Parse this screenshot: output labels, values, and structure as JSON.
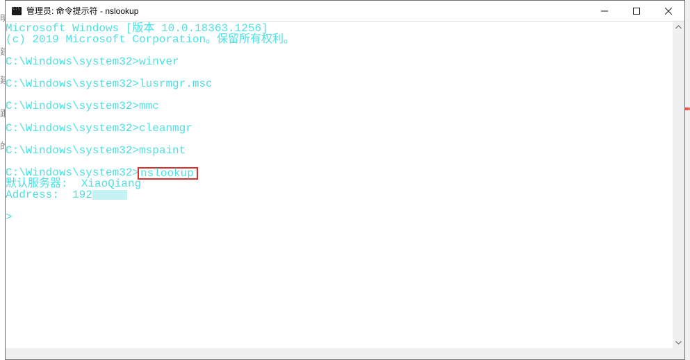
{
  "gutter": {
    "chars": [
      "明",
      "建",
      "建",
      "跟",
      "的"
    ]
  },
  "window": {
    "title": "管理员: 命令提示符 - nslookup"
  },
  "terminal": {
    "line_version": "Microsoft Windows [版本 10.0.18363.1256]",
    "line_copyright": "(c) 2019 Microsoft Corporation。保留所有权利。",
    "prompt": "C:\\Windows\\system32>",
    "cmd_winver": "winver",
    "cmd_lusrmgr": "lusrmgr.msc",
    "cmd_mmc": "mmc",
    "cmd_cleanmgr": "cleanmgr",
    "cmd_mspaint": "mspaint",
    "cmd_nslookup": "nslookup",
    "out_server_label": "默认服务器:  ",
    "out_server_name": "XiaoQiang",
    "out_address_label": "Address:  ",
    "out_address_value": "192",
    "sub_prompt": "> "
  }
}
